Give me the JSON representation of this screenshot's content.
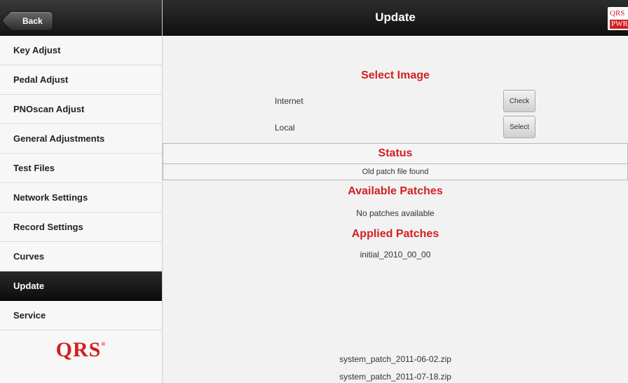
{
  "sidebar": {
    "back_label": "Back",
    "items": [
      {
        "label": "Key Adjust"
      },
      {
        "label": "Pedal Adjust"
      },
      {
        "label": "PNOscan Adjust"
      },
      {
        "label": "General Adjustments"
      },
      {
        "label": "Test Files"
      },
      {
        "label": "Network Settings"
      },
      {
        "label": "Record Settings"
      },
      {
        "label": "Curves"
      },
      {
        "label": "Update",
        "active": true
      },
      {
        "label": "Service"
      }
    ],
    "logo_text": "QRS",
    "logo_mark": "®"
  },
  "header": {
    "title": "Update",
    "logo_top": "QRS",
    "logo_bottom": "PWR"
  },
  "main": {
    "select_image_heading": "Select Image",
    "internet_label": "Internet",
    "check_button": "Check",
    "local_label": "Local",
    "select_button": "Select",
    "status_heading": "Status",
    "status_text": "Old patch file found",
    "available_heading": "Available Patches",
    "available_text": "No patches available",
    "applied_heading": "Applied Patches",
    "applied_text": "initial_2010_00_00",
    "files": [
      "system_patch_2011-06-02.zip",
      "system_patch_2011-07-18.zip"
    ]
  },
  "colors": {
    "accent_red": "#d21f23",
    "bar_dark": "#111111"
  }
}
